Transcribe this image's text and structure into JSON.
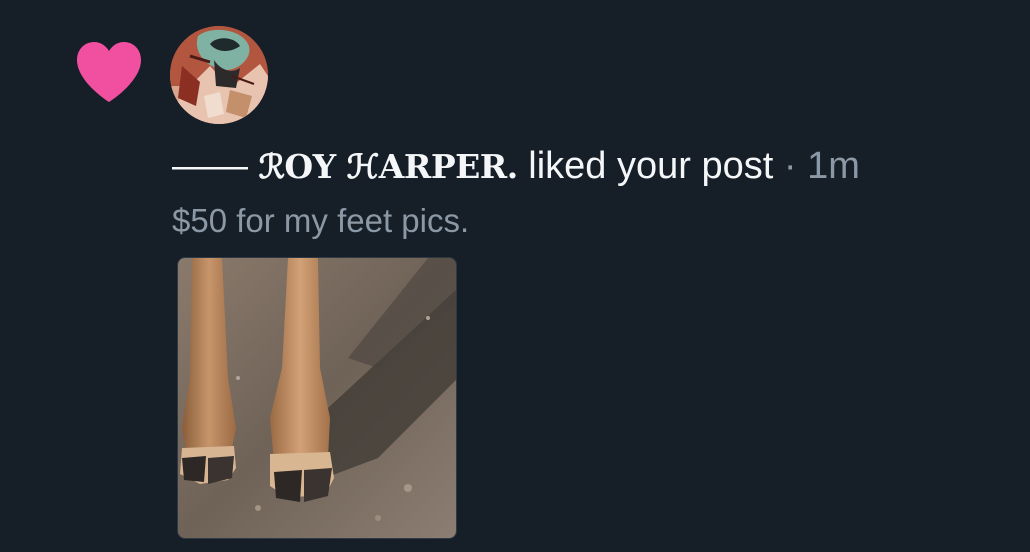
{
  "notification": {
    "type_icon": "heart-icon",
    "accent_color": "#f0509f",
    "avatar_alt": "profile picture",
    "dash": "——",
    "user_name": "ℛOY ℋARPER.",
    "action_text": "liked your post",
    "separator": "·",
    "time": "1m",
    "post_text": "$50 for my feet pics.",
    "post_image": "post-image-hooves"
  }
}
